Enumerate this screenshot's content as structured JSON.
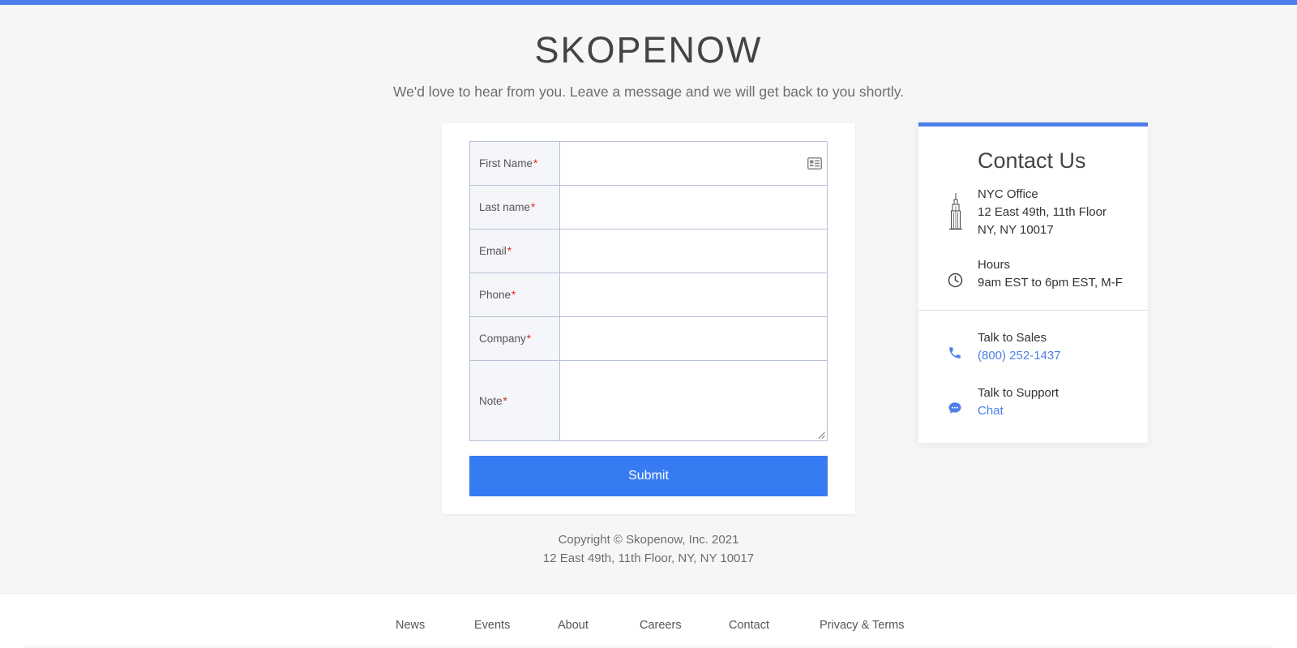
{
  "brand": {
    "name": "SKOPENOW",
    "tagline": "We'd love to hear from you. Leave a message and we will get back to you shortly."
  },
  "form": {
    "required_mark": "*",
    "fields": [
      {
        "label": "First Name",
        "value": ""
      },
      {
        "label": "Last name",
        "value": ""
      },
      {
        "label": "Email",
        "value": ""
      },
      {
        "label": "Phone",
        "value": ""
      },
      {
        "label": "Company",
        "value": ""
      },
      {
        "label": "Note",
        "value": ""
      }
    ],
    "submit_label": "Submit"
  },
  "contact": {
    "title": "Contact Us",
    "office": {
      "name": "NYC Office",
      "address_line1": "12 East 49th, 11th Floor",
      "address_line2": "NY, NY 10017",
      "icon": "building-icon"
    },
    "hours": {
      "label": "Hours",
      "value": "9am EST to 6pm EST, M-F",
      "icon": "clock-icon"
    },
    "sales": {
      "label": "Talk to Sales",
      "phone": "(800) 252-1437",
      "icon": "phone-icon"
    },
    "support": {
      "label": "Talk to Support",
      "link": "Chat",
      "icon": "chat-icon"
    }
  },
  "copyright": {
    "line1": "Copyright © Skopenow, Inc. 2021",
    "line2": "12 East 49th, 11th Floor, NY, NY 10017"
  },
  "footer": {
    "links": [
      "News",
      "Events",
      "About",
      "Careers",
      "Contact",
      "Privacy & Terms"
    ]
  },
  "colors": {
    "accent": "#4c7fe8",
    "submit": "#377bf2",
    "required": "#e02424",
    "background": "#f6f6f6"
  }
}
